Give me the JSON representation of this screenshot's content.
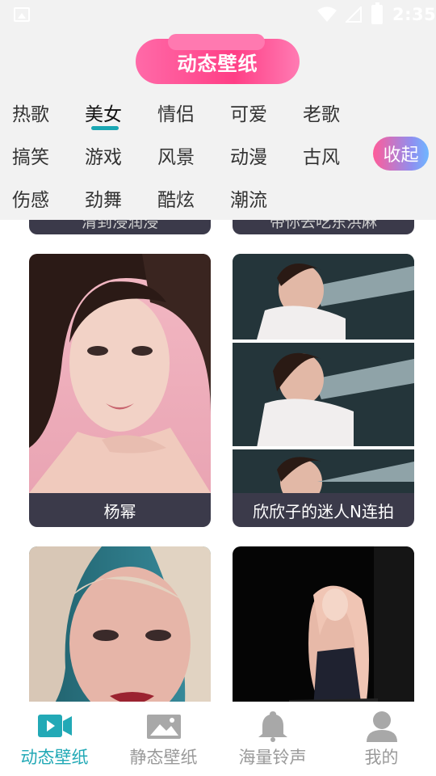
{
  "status_bar": {
    "time": "2:35"
  },
  "header": {
    "title": "动态壁纸",
    "categories": [
      "热歌",
      "美女",
      "情侣",
      "可爱",
      "老歌",
      "搞笑",
      "游戏",
      "风景",
      "动漫",
      "古风",
      "伤感",
      "劲舞",
      "酷炫",
      "潮流"
    ],
    "active_category": "美女",
    "collapse_label": "收起"
  },
  "cards": {
    "top_left_label": "清到浸润浸",
    "top_right_label": "带你去吃东洪麻",
    "items": [
      {
        "label": "杨幂"
      },
      {
        "label": "欣欣子的迷人N连拍"
      },
      {
        "label": ""
      },
      {
        "label": ""
      }
    ]
  },
  "bottom_nav": {
    "items": [
      {
        "label": "动态壁纸",
        "icon": "video-icon",
        "active": true
      },
      {
        "label": "静态壁纸",
        "icon": "image-icon",
        "active": false
      },
      {
        "label": "海量铃声",
        "icon": "bell-icon",
        "active": false
      },
      {
        "label": "我的",
        "icon": "profile-icon",
        "active": false
      }
    ]
  },
  "colors": {
    "accent": "#22a9b6",
    "title_pill": "#ff4f8f",
    "card_label_bg": "#3b3a4a"
  }
}
